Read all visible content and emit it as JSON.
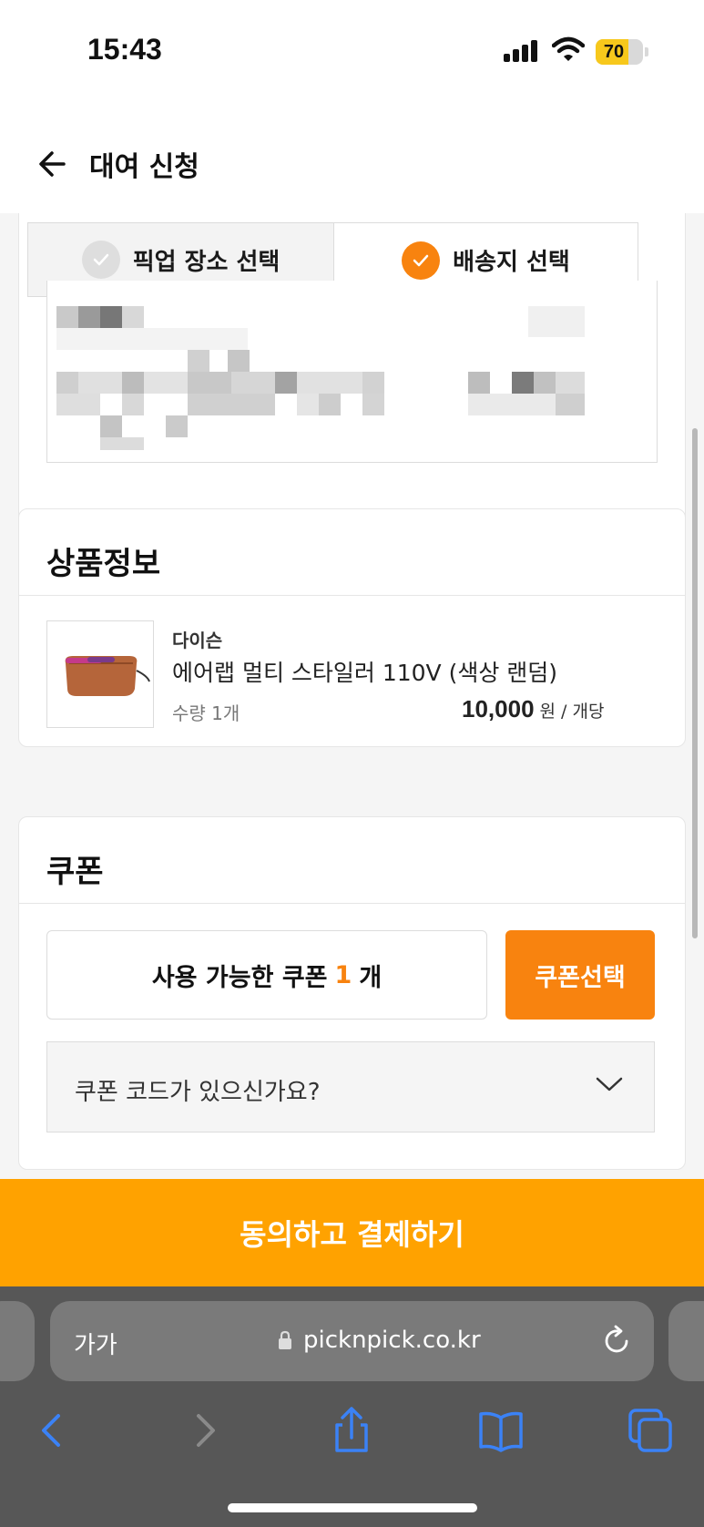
{
  "status_bar": {
    "time": "15:43",
    "battery_level": "70",
    "battery_fraction": 0.7
  },
  "header": {
    "title": "대여 신청"
  },
  "delivery_tabs": {
    "pickup_label": "픽업 장소 선택",
    "delivery_label": "배송지 선택",
    "selected": "delivery"
  },
  "product_section": {
    "title": "상품정보",
    "brand": "다이슨",
    "name": "에어랩 멀티 스타일러 110V (색상 랜덤)",
    "quantity": "수량 1개",
    "price": "10,000",
    "price_unit": "원 / 개당"
  },
  "coupon_section": {
    "title": "쿠폰",
    "available_prefix": "사용 가능한 쿠폰",
    "available_count": "1",
    "available_suffix": "개",
    "select_button": "쿠폰선택",
    "code_prompt": "쿠폰 코드가 있으신가요?"
  },
  "pay_button": "동의하고 결제하기",
  "browser": {
    "reader_label": "가가",
    "url": "picknpick.co.kr"
  },
  "colors": {
    "accent": "#f8830f",
    "pay_button": "#ffa200",
    "battery": "#f7c81c",
    "toolbar_icon": "#3b82f6"
  },
  "icons": [
    "arrow-left-icon",
    "check-icon",
    "chevron-down-icon",
    "lock-icon",
    "reload-icon",
    "back-icon",
    "forward-icon",
    "share-icon",
    "bookmarks-icon",
    "tabs-icon"
  ]
}
